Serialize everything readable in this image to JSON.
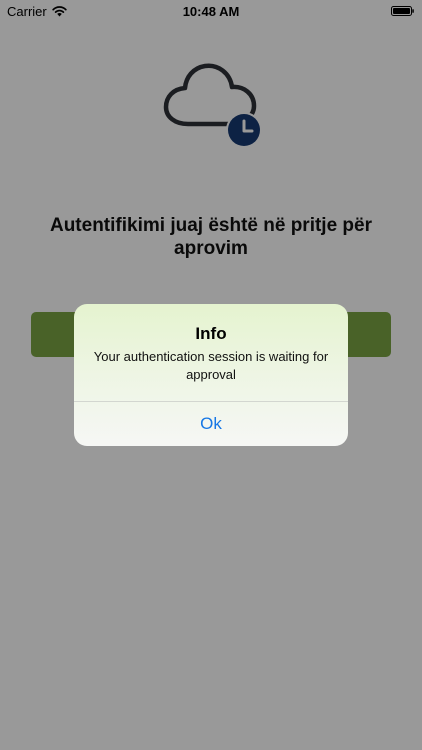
{
  "status_bar": {
    "carrier": "Carrier",
    "time": "10:48 AM"
  },
  "main": {
    "headline": "Autentifikimi juaj është në pritje për aprovim",
    "cloud_icon": "cloud-clock-icon",
    "button_color": "#7aa444"
  },
  "alert": {
    "title": "Info",
    "message": "Your authentication session is waiting for approval",
    "ok_label": "Ok",
    "ok_color": "#1677e5"
  },
  "colors": {
    "icon_stroke": "#2e3138",
    "clock_badge": "#173a72",
    "overlay": "rgba(0,0,0,0.40)"
  }
}
